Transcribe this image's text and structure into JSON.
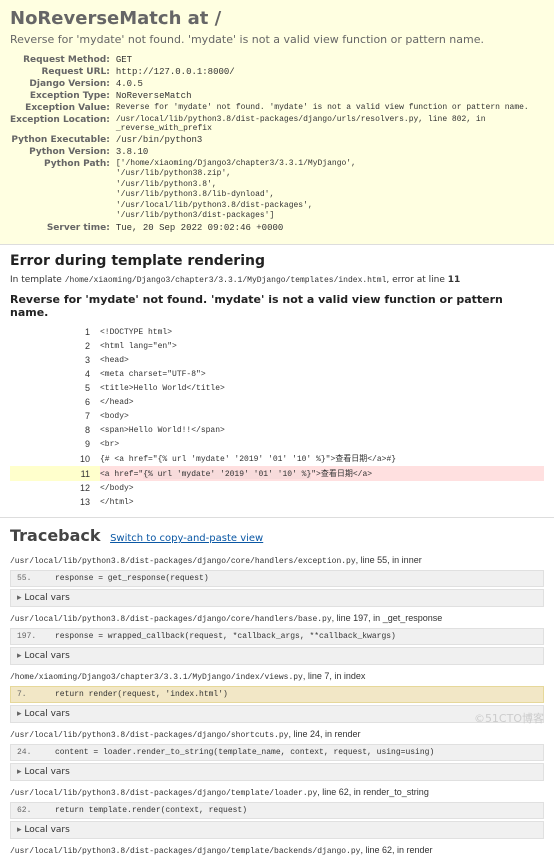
{
  "summary": {
    "title_exception": "NoReverseMatch",
    "title_at": " at /",
    "message": "Reverse for 'mydate' not found. 'mydate' is not a valid view function or pattern name.",
    "rows": {
      "request_method": {
        "label": "Request Method:",
        "value": "GET"
      },
      "request_url": {
        "label": "Request URL:",
        "value": "http://127.0.0.1:8000/"
      },
      "django_version": {
        "label": "Django Version:",
        "value": "4.0.5"
      },
      "exception_type": {
        "label": "Exception Type:",
        "value": "NoReverseMatch"
      },
      "exception_value": {
        "label": "Exception Value:",
        "value": "Reverse for 'mydate' not found. 'mydate' is not a valid view function or pattern name."
      },
      "exception_location": {
        "label": "Exception Location:",
        "value": "/usr/local/lib/python3.8/dist-packages/django/urls/resolvers.py, line 802, in _reverse_with_prefix"
      },
      "python_executable": {
        "label": "Python Executable:",
        "value": "/usr/bin/python3"
      },
      "python_version": {
        "label": "Python Version:",
        "value": "3.8.10"
      },
      "python_path": {
        "label": "Python Path:"
      },
      "server_time": {
        "label": "Server time:",
        "value": "Tue, 20 Sep 2022 09:02:46 +0000"
      }
    },
    "python_path_items": [
      "['/home/xiaoming/Django3/chapter3/3.3.1/MyDjango',",
      " '/usr/lib/python38.zip',",
      " '/usr/lib/python3.8',",
      " '/usr/lib/python3.8/lib-dynload',",
      " '/usr/local/lib/python3.8/dist-packages',",
      " '/usr/lib/python3/dist-packages']"
    ]
  },
  "template": {
    "heading": "Error during template rendering",
    "in_template_prefix": "In template ",
    "template_path": "/home/xiaoming/Django3/chapter3/3.3.1/MyDjango/templates/index.html",
    "error_at": ", error at line ",
    "error_line": "11",
    "subheading": "Reverse for 'mydate' not found. 'mydate' is not a valid view function or pattern name.",
    "source": [
      {
        "n": "1",
        "c": "<!DOCTYPE html>"
      },
      {
        "n": "2",
        "c": "<html lang=\"en\">"
      },
      {
        "n": "3",
        "c": "<head>"
      },
      {
        "n": "4",
        "c": "    <meta charset=\"UTF-8\">"
      },
      {
        "n": "5",
        "c": "    <title>Hello World</title>"
      },
      {
        "n": "6",
        "c": "</head>"
      },
      {
        "n": "7",
        "c": "<body>"
      },
      {
        "n": "8",
        "c": "    <span>Hello World!!</span>"
      },
      {
        "n": "9",
        "c": "    <br>"
      },
      {
        "n": "10",
        "c": "    {# <a href=\"{% url 'mydate' '2019' '01' '10' %}\">查看日期</a>#}"
      },
      {
        "n": "11",
        "pre": "    <a href=\"",
        "hl": "{% url 'mydate' '2019' '01' '10' %}",
        "post": "\">查看日期</a>",
        "err": true
      },
      {
        "n": "12",
        "c": "</body>"
      },
      {
        "n": "13",
        "c": "</html>"
      }
    ]
  },
  "traceback": {
    "heading": "Traceback",
    "switch": "Switch to copy-and-paste view",
    "local_vars_label": "Local vars",
    "frames": [
      {
        "loc": "/usr/local/lib/python3.8/dist-packages/django/core/handlers/exception.py",
        "linfo": ", line 55, in inner",
        "ln": "55.",
        "code": "            response = get_response(request)"
      },
      {
        "loc": "/usr/local/lib/python3.8/dist-packages/django/core/handlers/base.py",
        "linfo": ", line 197, in _get_response",
        "ln": "197.",
        "code": "                response = wrapped_callback(request, *callback_args, **callback_kwargs)"
      },
      {
        "loc": "/home/xiaoming/Django3/chapter3/3.3.1/MyDjango/index/views.py",
        "linfo": ", line 7, in index",
        "ln": "7.",
        "code": "    return render(request, 'index.html')",
        "hl": true
      },
      {
        "loc": "/usr/local/lib/python3.8/dist-packages/django/shortcuts.py",
        "linfo": ", line 24, in render",
        "ln": "24.",
        "code": "    content = loader.render_to_string(template_name, context, request, using=using)"
      },
      {
        "loc": "/usr/local/lib/python3.8/dist-packages/django/template/loader.py",
        "linfo": ", line 62, in render_to_string",
        "ln": "62.",
        "code": "    return template.render(context, request)"
      },
      {
        "loc": "/usr/local/lib/python3.8/dist-packages/django/template/backends/django.py",
        "linfo": ", line 62, in render",
        "nocode": true
      }
    ]
  },
  "watermark": "©51CTO博客"
}
